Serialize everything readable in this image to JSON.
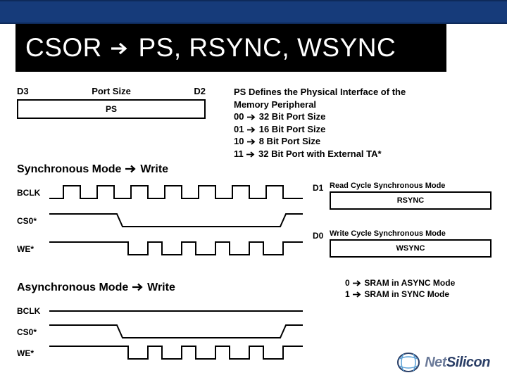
{
  "title_parts": {
    "a": "CSOR",
    "b": "PS, RSYNC, WSYNC"
  },
  "port_size": {
    "left_bit": "D3",
    "label": "Port Size",
    "right_bit": "D2",
    "box": "PS"
  },
  "psdef": {
    "l1": "PS Defines the Physical Interface of the",
    "l2": "Memory Peripheral",
    "l3a": "00",
    "l3b": "32 Bit Port Size",
    "l4a": "01",
    "l4b": "16 Bit Port Size",
    "l5a": "10",
    "l5b": "8 Bit Port Size",
    "l6a": "11",
    "l6b": "32 Bit Port with External TA*"
  },
  "sections": {
    "sync": "Synchronous Mode",
    "write": "Write",
    "async": "Asynchronous Mode"
  },
  "signals": {
    "bclk": "BCLK",
    "cs0": "CS0*",
    "we": "WE*"
  },
  "registers": {
    "d1": "D1",
    "d0": "D0",
    "rsync_caption": "Read Cycle Synchronous Mode",
    "rsync": "RSYNC",
    "wsync_caption": "Write Cycle Synchronous Mode",
    "wsync": "WSYNC"
  },
  "mode_note": {
    "l1a": "0",
    "l1b": "SRAM in ASYNC Mode",
    "l2a": "1",
    "l2b": "SRAM in SYNC Mode"
  },
  "logo": {
    "a": "Net",
    "b": "Silicon"
  }
}
